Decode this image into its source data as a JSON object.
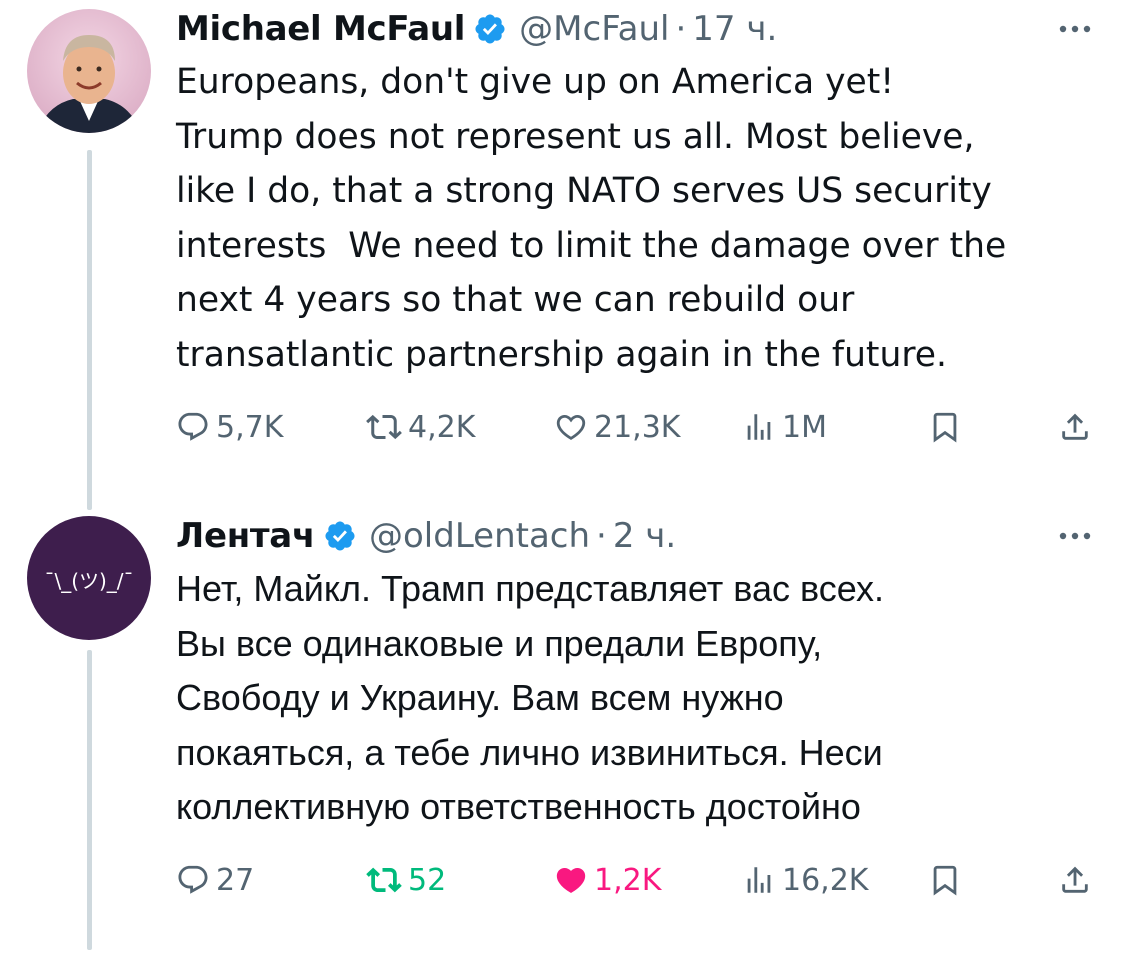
{
  "tweets": [
    {
      "display_name": "Michael McFaul",
      "handle": "@McFaul",
      "separator": "·",
      "time": "17 ч.",
      "text": "Europeans, don't give up on America yet!\nTrump does not represent us all. Most believe,\nlike I do, that a strong NATO serves US security\ninterests  We need to limit the damage over the\nnext 4 years so that we can rebuild our\ntransatlantic partnership again in the future.",
      "replies": "5,7K",
      "reposts": "4,2K",
      "likes": "21,3K",
      "views": "1M",
      "reposted": false,
      "liked": false
    },
    {
      "display_name": "Лентач",
      "handle": "@oldLentach",
      "separator": "·",
      "time": "2 ч.",
      "text": "Нет, Майкл. Трамп представляет вас всех.\nВы все одинаковые и предали Европу,\nСвободу и Украину. Вам всем нужно\nпокаяться, а тебе лично извиниться. Неси\nколлективную ответственность достойно",
      "avatar_text": "¯\\_(ツ)_/¯",
      "replies": "27",
      "reposts": "52",
      "likes": "1,2K",
      "views": "16,2K",
      "reposted": true,
      "liked": true
    }
  ],
  "colors": {
    "text": "#0f1419",
    "secondary": "#536471",
    "verified": "#1d9bf0",
    "repost_active": "#00ba7c",
    "like_active": "#f91880",
    "thread_line": "#cfd9de",
    "lentach_avatar_bg": "#3e1e4d"
  },
  "icons": [
    "reply-icon",
    "repost-icon",
    "like-icon",
    "views-icon",
    "bookmark-icon",
    "share-icon",
    "more-icon",
    "verified-badge-icon"
  ]
}
